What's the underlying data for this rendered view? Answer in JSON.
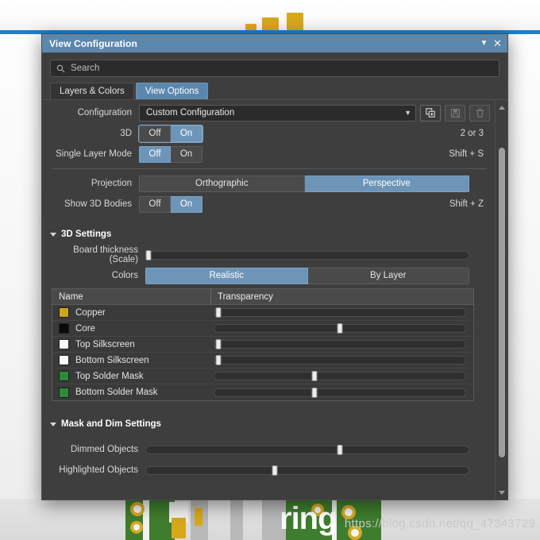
{
  "window": {
    "title": "View Configuration",
    "collapse_icon": "chevron-down-icon",
    "close_icon": "close-icon"
  },
  "search": {
    "placeholder": "Search",
    "value": "",
    "icon": "search-icon"
  },
  "tabs": [
    {
      "label": "Layers & Colors",
      "active": false
    },
    {
      "label": "View Options",
      "active": true
    }
  ],
  "configuration": {
    "label": "Configuration",
    "value": "Custom Configuration",
    "caret": "chevron-down-icon",
    "actions": [
      {
        "name": "add-configuration-icon",
        "label": "Add",
        "disabled": false
      },
      {
        "name": "save-configuration-icon",
        "label": "Save",
        "disabled": true
      },
      {
        "name": "delete-configuration-icon",
        "label": "Delete",
        "disabled": true
      }
    ]
  },
  "toggles": [
    {
      "label": "3D",
      "options": [
        "Off",
        "On"
      ],
      "selected": "On",
      "hint": "2 or 3",
      "focused": true
    },
    {
      "label": "Single Layer Mode",
      "options": [
        "Off",
        "On"
      ],
      "selected": "Off",
      "hint": "Shift + S",
      "focused": false
    }
  ],
  "projection": {
    "label": "Projection",
    "options": [
      "Orthographic",
      "Perspective"
    ],
    "selected": "Perspective",
    "hint": ""
  },
  "show_3d_bodies": {
    "label": "Show 3D Bodies",
    "options": [
      "Off",
      "On"
    ],
    "selected": "On",
    "hint": "Shift + Z"
  },
  "settings_3d": {
    "title": "3D Settings",
    "board_thickness": {
      "label": "Board thickness (Scale)",
      "value": 1
    },
    "colors": {
      "label": "Colors",
      "options": [
        "Realistic",
        "By Layer"
      ],
      "selected": "Realistic"
    },
    "table": {
      "columns": [
        "Name",
        "Transparency"
      ],
      "rows": [
        {
          "name": "Copper",
          "color": "#cba51f",
          "transparency": 2
        },
        {
          "name": "Core",
          "color": "#0a0a0a",
          "transparency": 50
        },
        {
          "name": "Top Silkscreen",
          "color": "#fafafa",
          "transparency": 2
        },
        {
          "name": "Bottom Silkscreen",
          "color": "#fafafa",
          "transparency": 2
        },
        {
          "name": "Top Solder Mask",
          "color": "#2e8b3a",
          "transparency": 40
        },
        {
          "name": "Bottom Solder Mask",
          "color": "#2e8b3a",
          "transparency": 40
        }
      ]
    }
  },
  "mask_dim_settings": {
    "title": "Mask and Dim Settings",
    "sliders": [
      {
        "label": "Dimmed Objects",
        "value": 60
      },
      {
        "label": "Highlighted Objects",
        "value": 40
      }
    ]
  },
  "scrollbar": {
    "up_icon": "triangle-up-icon",
    "down_icon": "triangle-down-icon"
  },
  "backdrop": {
    "watermark": "https://blog.csdn.net/qq_47343729",
    "overlay_text": "ring"
  },
  "colors": {
    "accent": "#5b87ad",
    "panel": "#3e3e3e",
    "field": "#2b2b2b",
    "toggle_on": "#6d95b8"
  }
}
